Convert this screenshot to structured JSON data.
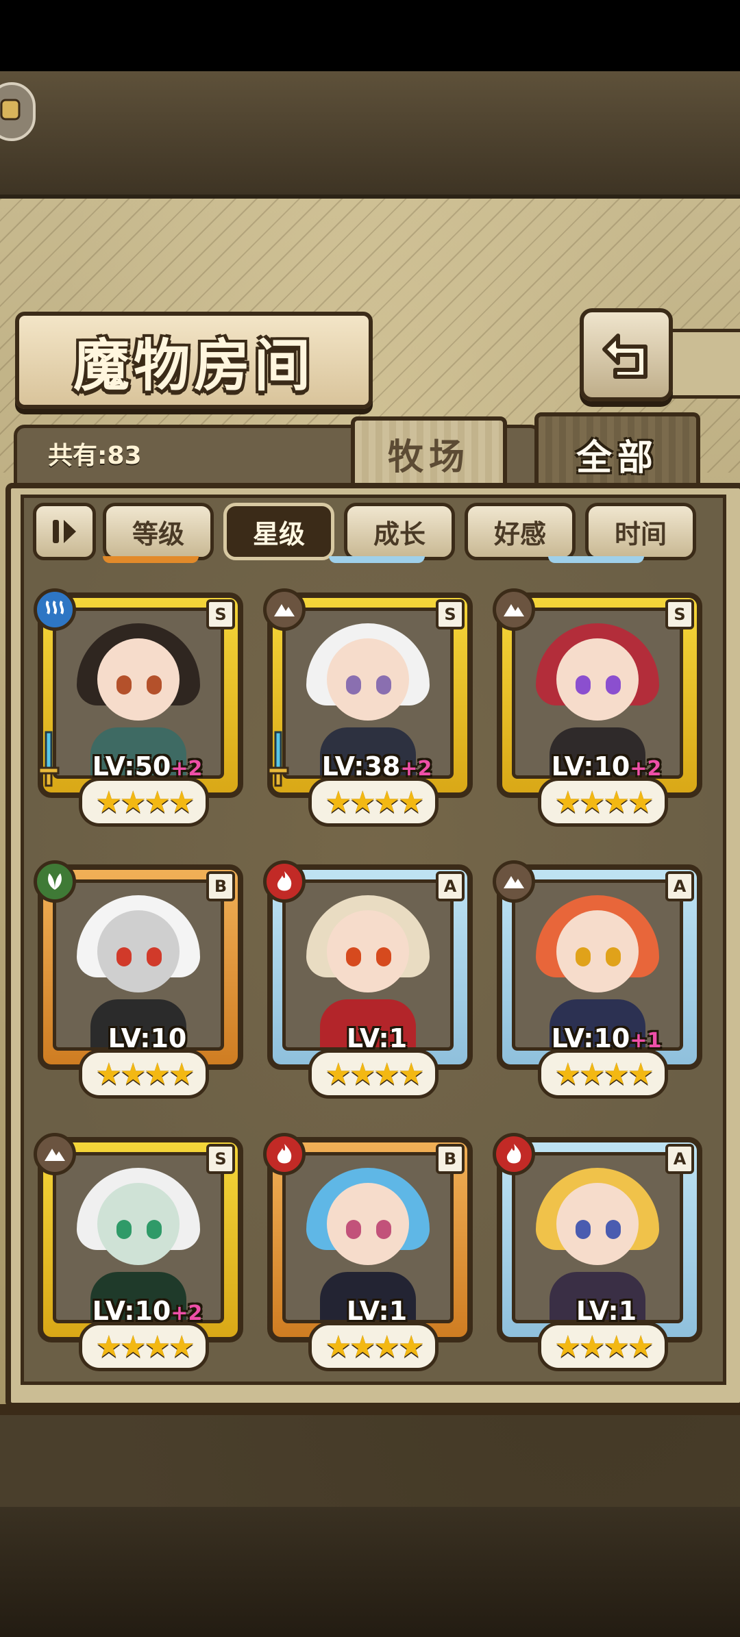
{
  "header": {
    "title": "魔物房间",
    "back_icon": "return-arrow-icon"
  },
  "summary": {
    "count_label": "共有:83"
  },
  "tabs": [
    {
      "label": "牧场",
      "active": false
    },
    {
      "label": "全部",
      "active": true
    }
  ],
  "sort": {
    "toggle_icon": "sort-order-icon",
    "buttons": [
      {
        "label": "等级",
        "active": false
      },
      {
        "label": "星级",
        "active": true
      },
      {
        "label": "成长",
        "active": false
      },
      {
        "label": "好感",
        "active": false
      },
      {
        "label": "时间",
        "active": false
      }
    ]
  },
  "monsters": [
    {
      "rank": "S",
      "element": "water",
      "level": "LV:50",
      "bonus": "+2",
      "stars": "★★★★",
      "equipped": true
    },
    {
      "rank": "S",
      "element": "earth",
      "level": "LV:38",
      "bonus": "+2",
      "stars": "★★★★",
      "equipped": true
    },
    {
      "rank": "S",
      "element": "earth",
      "level": "LV:10",
      "bonus": "+2",
      "stars": "★★★★",
      "equipped": false
    },
    {
      "rank": "B",
      "element": "grass",
      "level": "LV:10",
      "bonus": "",
      "stars": "★★★★",
      "equipped": false
    },
    {
      "rank": "A",
      "element": "fire",
      "level": "LV:1",
      "bonus": "",
      "stars": "★★★★",
      "equipped": false
    },
    {
      "rank": "A",
      "element": "earth",
      "level": "LV:10",
      "bonus": "+1",
      "stars": "★★★★",
      "equipped": false
    },
    {
      "rank": "S",
      "element": "earth",
      "level": "LV:10",
      "bonus": "+2",
      "stars": "★★★★",
      "equipped": false
    },
    {
      "rank": "B",
      "element": "fire",
      "level": "LV:1",
      "bonus": "",
      "stars": "★★★★",
      "equipped": false
    },
    {
      "rank": "A",
      "element": "fire",
      "level": "LV:1",
      "bonus": "",
      "stars": "★★★★",
      "equipped": false
    }
  ],
  "colors": {
    "frame_s": "#f5d63a",
    "frame_a": "#bfe3f3",
    "frame_b": "#f1b057",
    "outline": "#3b2b18",
    "bonus": "#ee4fa8"
  }
}
